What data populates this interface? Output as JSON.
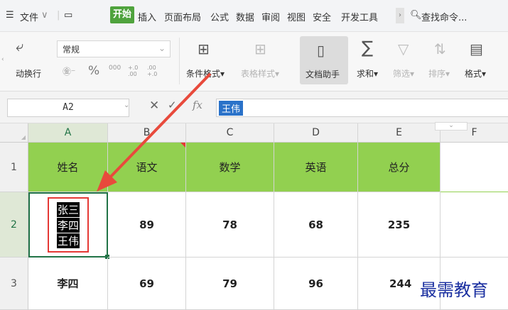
{
  "menubar": {
    "file_label": "文件",
    "start_tab": "开始",
    "tabs": [
      "插入",
      "页面布局",
      "公式",
      "数据",
      "审阅",
      "视图",
      "安全",
      "开发工具"
    ],
    "search_label": "查找命令..."
  },
  "ribbon": {
    "wrap_text": "动换行",
    "number_format": "常规",
    "conditional_format": "条件格式",
    "table_style": "表格样式",
    "doc_assistant": "文档助手",
    "sum": "求和",
    "filter": "筛选",
    "sort": "排序",
    "format": "格式",
    "percent": "%",
    "thousands": "000",
    "inc_decimal": "+.0 .00",
    "dec_decimal": ".00 +.0"
  },
  "formula_bar": {
    "name_box": "A2",
    "fx_label": "fx",
    "value": "王伟"
  },
  "grid": {
    "columns": [
      "A",
      "B",
      "C",
      "D",
      "E",
      "F"
    ],
    "rows": [
      "1",
      "2",
      "3"
    ],
    "header_row": [
      "姓名",
      "语文",
      "数学",
      "英语",
      "总分"
    ],
    "row2": {
      "names": [
        "张三",
        "李四",
        "王伟"
      ],
      "values": [
        "89",
        "78",
        "68",
        "235"
      ]
    },
    "row3": [
      "李四",
      "69",
      "79",
      "96",
      "244"
    ]
  },
  "watermark": "最需教育",
  "colors": {
    "header_fill": "#92d050",
    "active_tab": "#4fa33d",
    "highlight_box": "#e53935",
    "arrow": "#e84a3c",
    "selection": "#217346"
  }
}
